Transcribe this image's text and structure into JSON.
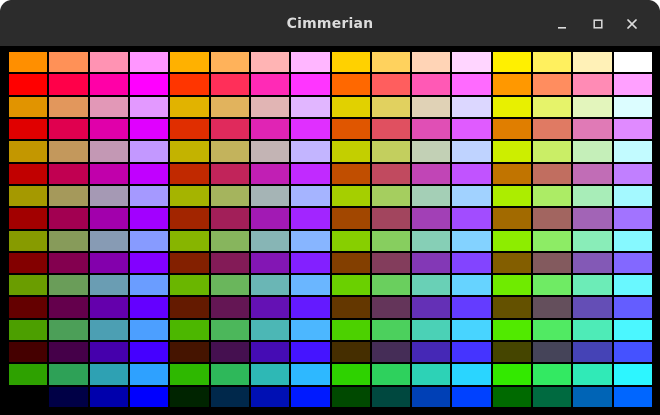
{
  "window": {
    "title": "Cimmerian",
    "buttons": [
      {
        "name": "minimize-button",
        "icon": "minimize-icon"
      },
      {
        "name": "maximize-button",
        "icon": "maximize-icon"
      },
      {
        "name": "close-button",
        "icon": "close-icon"
      }
    ]
  },
  "colors": {
    "titlebar": "#2c2c2c",
    "title_text": "#dcdcdc",
    "background": "#000000"
  },
  "palette": [
    [
      "#ff8f00",
      "#ff9157",
      "#ff93b3",
      "#ff96ff",
      "#ffb100",
      "#ffb25a",
      "#ffb4b4",
      "#ffb6ff",
      "#ffd100",
      "#ffd25d",
      "#ffd4b6",
      "#ffd5ff",
      "#fff000",
      "#fff05e",
      "#fff1b7",
      "#ffffff"
    ],
    [
      "#ff0000",
      "#ff0049",
      "#ff00a7",
      "#ff00ff",
      "#ff3500",
      "#ff2f59",
      "#ff2ab6",
      "#ff35ff",
      "#ff6800",
      "#ff5e5e",
      "#ff59b5",
      "#ff6aff",
      "#ff9800",
      "#ff8d5f",
      "#ff8bb5",
      "#ffa0ff"
    ],
    [
      "#e19400",
      "#e2975c",
      "#e298b7",
      "#e399ff",
      "#e1b300",
      "#e1b35d",
      "#e1b5b4",
      "#e1b6ff",
      "#e1d100",
      "#e1d15f",
      "#e0d2b6",
      "#dcd7ff",
      "#e8f000",
      "#e6f36a",
      "#e3f5bc",
      "#dcfdff"
    ],
    [
      "#e00000",
      "#e0004f",
      "#e000aa",
      "#e000ff",
      "#e02e00",
      "#e02a5c",
      "#e024b4",
      "#e02fff",
      "#e05600",
      "#e05060",
      "#e04fb5",
      "#e05bff",
      "#e07e00",
      "#e07a63",
      "#e07ab6",
      "#e08aff"
    ],
    [
      "#c39700",
      "#c3985c",
      "#c398b4",
      "#c398ff",
      "#c3b300",
      "#c3b35c",
      "#c3b4b4",
      "#c3b5ff",
      "#c3cf00",
      "#c3cf5e",
      "#c2d0b5",
      "#bfd3ff",
      "#ccee00",
      "#caee66",
      "#c5efb9",
      "#c2fbff"
    ],
    [
      "#c10000",
      "#c10051",
      "#c100ab",
      "#c100ff",
      "#c12900",
      "#c1245a",
      "#c11fb4",
      "#c12aff",
      "#c14e00",
      "#c14a5f",
      "#c145b6",
      "#c153ff",
      "#c17400",
      "#c16e60",
      "#c16db6",
      "#c17fff"
    ],
    [
      "#a59900",
      "#a5995b",
      "#a599b4",
      "#a599ff",
      "#a5b400",
      "#a5b45d",
      "#a5b4b5",
      "#a5b4ff",
      "#a5cf00",
      "#a5ce5f",
      "#a4cfb6",
      "#a1d2ff",
      "#aced00",
      "#acec65",
      "#a8edb8",
      "#a4f9ff"
    ],
    [
      "#a20000",
      "#a20051",
      "#a200ac",
      "#a200ff",
      "#a22500",
      "#a21f59",
      "#a21ab4",
      "#a225ff",
      "#a24700",
      "#a2455e",
      "#a240b6",
      "#a24cff",
      "#a26a00",
      "#a26560",
      "#a264b6",
      "#a273ff"
    ],
    [
      "#879b00",
      "#879b5a",
      "#879bb4",
      "#879bff",
      "#87b500",
      "#87b55d",
      "#87b5b5",
      "#87b5ff",
      "#87cf00",
      "#87ce5f",
      "#86cfb6",
      "#83d2ff",
      "#8ded00",
      "#8dec65",
      "#89edb8",
      "#86f9ff"
    ],
    [
      "#830000",
      "#83004f",
      "#8300ac",
      "#8300ff",
      "#832000",
      "#831b57",
      "#8316b4",
      "#8320ff",
      "#833f00",
      "#833d5c",
      "#8338b6",
      "#8344ff",
      "#835e00",
      "#835a5e",
      "#8359b6",
      "#8368ff"
    ],
    [
      "#6a9d00",
      "#6a9d59",
      "#6a9db3",
      "#6a9dff",
      "#6ab600",
      "#6ab65c",
      "#6ab6b5",
      "#6ab6ff",
      "#6ad000",
      "#6acf5e",
      "#69d0b6",
      "#66d3ff",
      "#6feb00",
      "#6feb64",
      "#6cecb7",
      "#69f8ff"
    ],
    [
      "#640000",
      "#64004c",
      "#6400ac",
      "#6400ff",
      "#641a00",
      "#641654",
      "#6411b4",
      "#641aff",
      "#643700",
      "#64355a",
      "#6430b6",
      "#643cff",
      "#645100",
      "#644f5c",
      "#644eb6",
      "#645dff"
    ],
    [
      "#4c9f00",
      "#4c9f58",
      "#4c9fb3",
      "#4c9fff",
      "#4cb700",
      "#4cb75b",
      "#4cb7b5",
      "#4cb7ff",
      "#4cd100",
      "#4cd05d",
      "#4bd1b6",
      "#48d4ff",
      "#51ea00",
      "#51ea63",
      "#4eebb7",
      "#4bf7ff"
    ],
    [
      "#450000",
      "#450049",
      "#4500ac",
      "#4500ff",
      "#451400",
      "#451050",
      "#450cb4",
      "#4514ff",
      "#452e00",
      "#452d57",
      "#4528b6",
      "#4534ff",
      "#454500",
      "#454459",
      "#4543b6",
      "#4552ff"
    ],
    [
      "#2ea100",
      "#2ea157",
      "#2ea1b3",
      "#2ea1ff",
      "#2eb800",
      "#2eb85a",
      "#2eb8b5",
      "#2eb8ff",
      "#2ed200",
      "#2ed15d",
      "#2dd2b6",
      "#2ad5ff",
      "#33e900",
      "#33e962",
      "#30eab7",
      "#2df6ff"
    ],
    [
      "#000000",
      "#000046",
      "#0000ac",
      "#0000ff",
      "#002400",
      "#00284b",
      "#0010b4",
      "#001aff",
      "#004900",
      "#00483f",
      "#0040b6",
      "#0041ff",
      "#006a00",
      "#006a40",
      "#0064b6",
      "#0066ff"
    ]
  ]
}
